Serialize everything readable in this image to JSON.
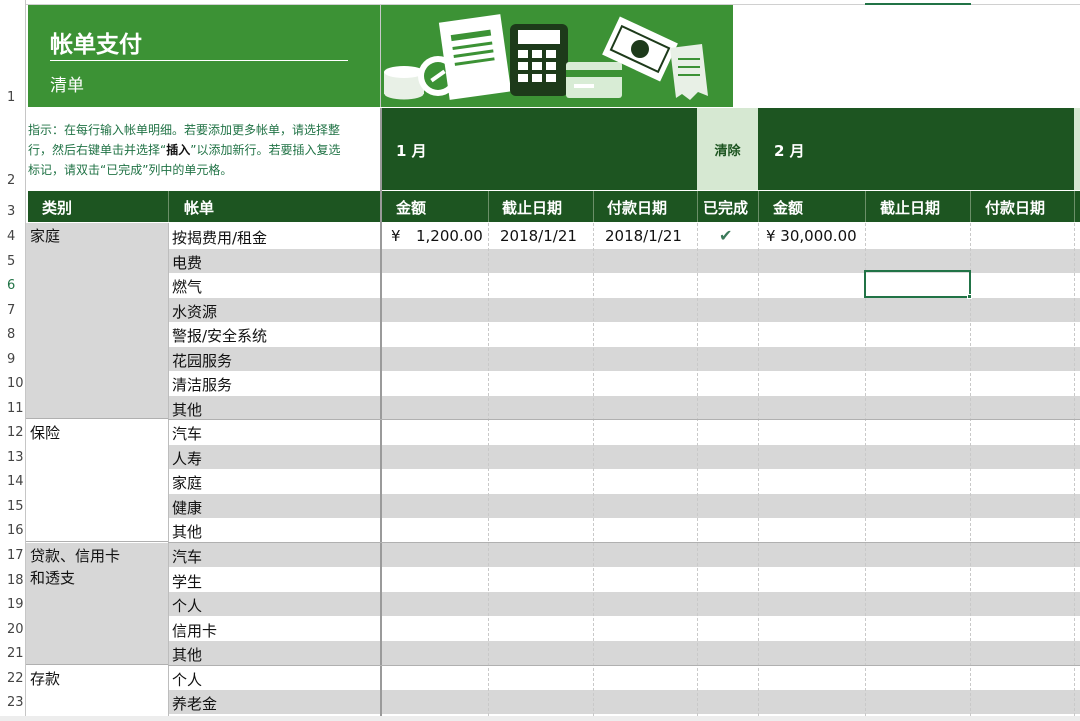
{
  "title": {
    "main": "帐单支付",
    "sub": "清单"
  },
  "instructions": {
    "line1": "指示：在每行输入帐单明细。若要添加更多帐单，请选择整",
    "line2a": "行，然后右键单击并选择“",
    "line2b": "插入",
    "line2c": "”以添加新行。若要插入复选",
    "line3": "标记，请双击“已完成”列中的单元格。"
  },
  "months": {
    "jan": "1 月",
    "feb": "2 月"
  },
  "clear_label": "清除",
  "headers": {
    "category": "类别",
    "bill": "帐单",
    "amount": "金额",
    "due": "截止日期",
    "paid": "付款日期",
    "done": "已完成",
    "amount2": "金额",
    "due2": "截止日期",
    "paid2": "付款日期"
  },
  "row_numbers": [
    "1",
    "2",
    "3",
    "4",
    "5",
    "6",
    "7",
    "8",
    "9",
    "10",
    "11",
    "12",
    "13",
    "14",
    "15",
    "16",
    "17",
    "18",
    "19",
    "20",
    "21",
    "22",
    "23"
  ],
  "categories": {
    "home": "家庭",
    "insurance": "保险",
    "loan_line1": "贷款、信用卡",
    "loan_line2": "和透支",
    "savings": "存款"
  },
  "bills": [
    "按揭费用/租金",
    "电费",
    "燃气",
    "水资源",
    "警报/安全系统",
    "花园服务",
    "清洁服务",
    "其他",
    "汽车",
    "人寿",
    "家庭",
    "健康",
    "其他",
    "汽车",
    "学生",
    "个人",
    "信用卡",
    "其他",
    "个人",
    "养老金"
  ],
  "row4": {
    "currency": "¥",
    "jan_amount": "1,200.00",
    "jan_due": "2018/1/21",
    "jan_paid": "2018/1/21",
    "done_mark": "✔",
    "feb_amount": "¥ 30,000.00"
  },
  "icons": [
    "coins-icon",
    "invoice-icon",
    "calculator-icon",
    "credit-card-icon",
    "banknotes-icon",
    "receipt-icon"
  ],
  "colors": {
    "title_green": "#3c9235",
    "dark_green": "#1d5521",
    "stripe_gray": "#d7d7d7",
    "selection": "#217346"
  }
}
